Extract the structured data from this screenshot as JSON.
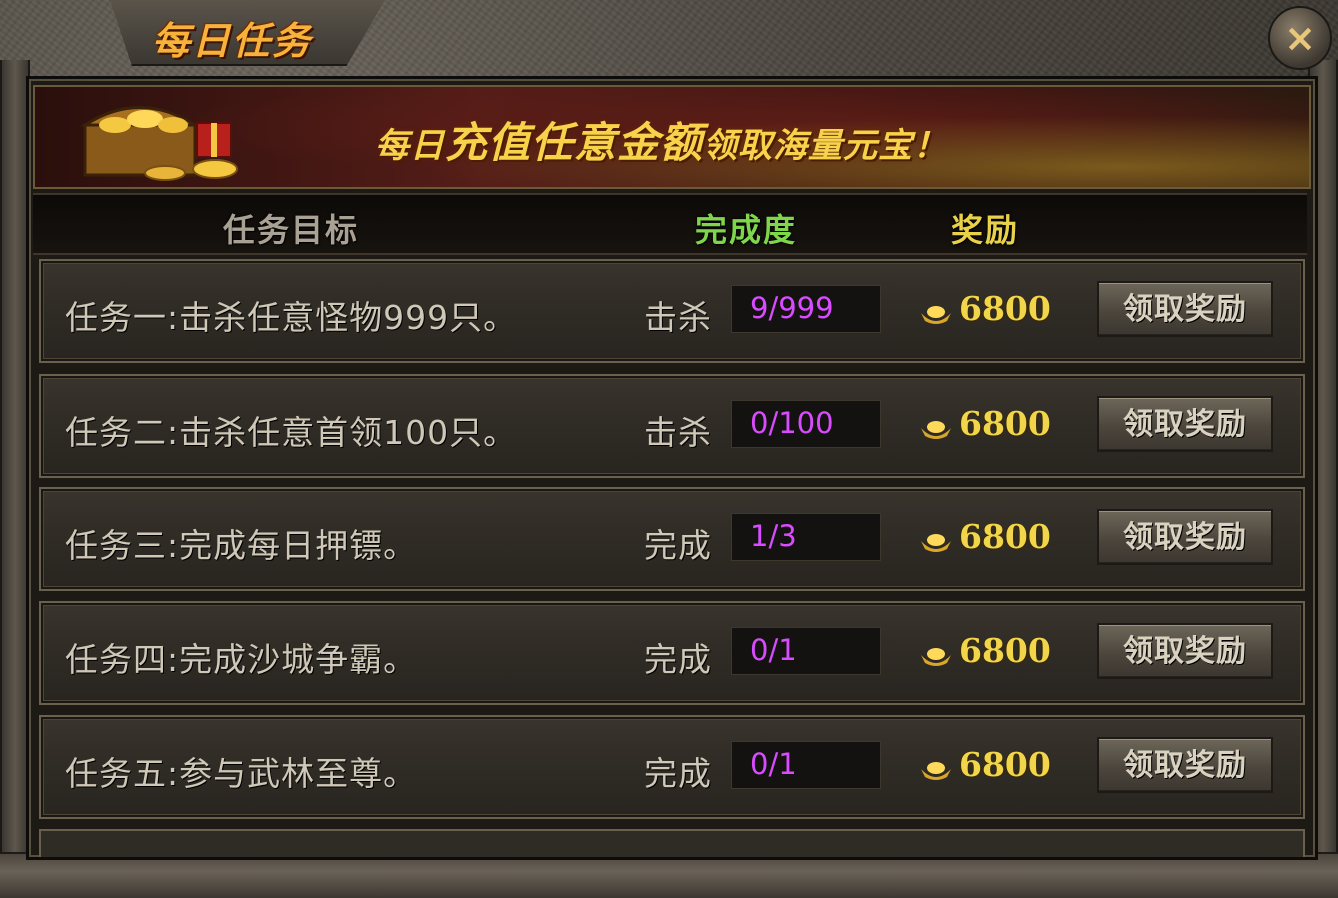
{
  "title": "每日任务",
  "close_icon": "×",
  "banner": {
    "text_part1": "每日",
    "text_part2": "充值任意金额",
    "text_part3": "领取海量元宝！"
  },
  "columns": {
    "goal": "任务目标",
    "progress": "完成度",
    "reward": "奖励"
  },
  "colors": {
    "accent_gold": "#f1d64c",
    "progress_purple": "#d84bff",
    "header_green": "#7fd64a"
  },
  "tasks": [
    {
      "label": "任务一:击杀任意怪物999只。",
      "action": "击杀",
      "progress": "9/999",
      "reward": "6800",
      "button": "领取奖励"
    },
    {
      "label": "任务二:击杀任意首领100只。",
      "action": "击杀",
      "progress": "0/100",
      "reward": "6800",
      "button": "领取奖励"
    },
    {
      "label": "任务三:完成每日押镖。",
      "action": "完成",
      "progress": "1/3",
      "reward": "6800",
      "button": "领取奖励"
    },
    {
      "label": "任务四:完成沙城争霸。",
      "action": "完成",
      "progress": "0/1",
      "reward": "6800",
      "button": "领取奖励"
    },
    {
      "label": "任务五:参与武林至尊。",
      "action": "完成",
      "progress": "0/1",
      "reward": "6800",
      "button": "领取奖励"
    }
  ]
}
